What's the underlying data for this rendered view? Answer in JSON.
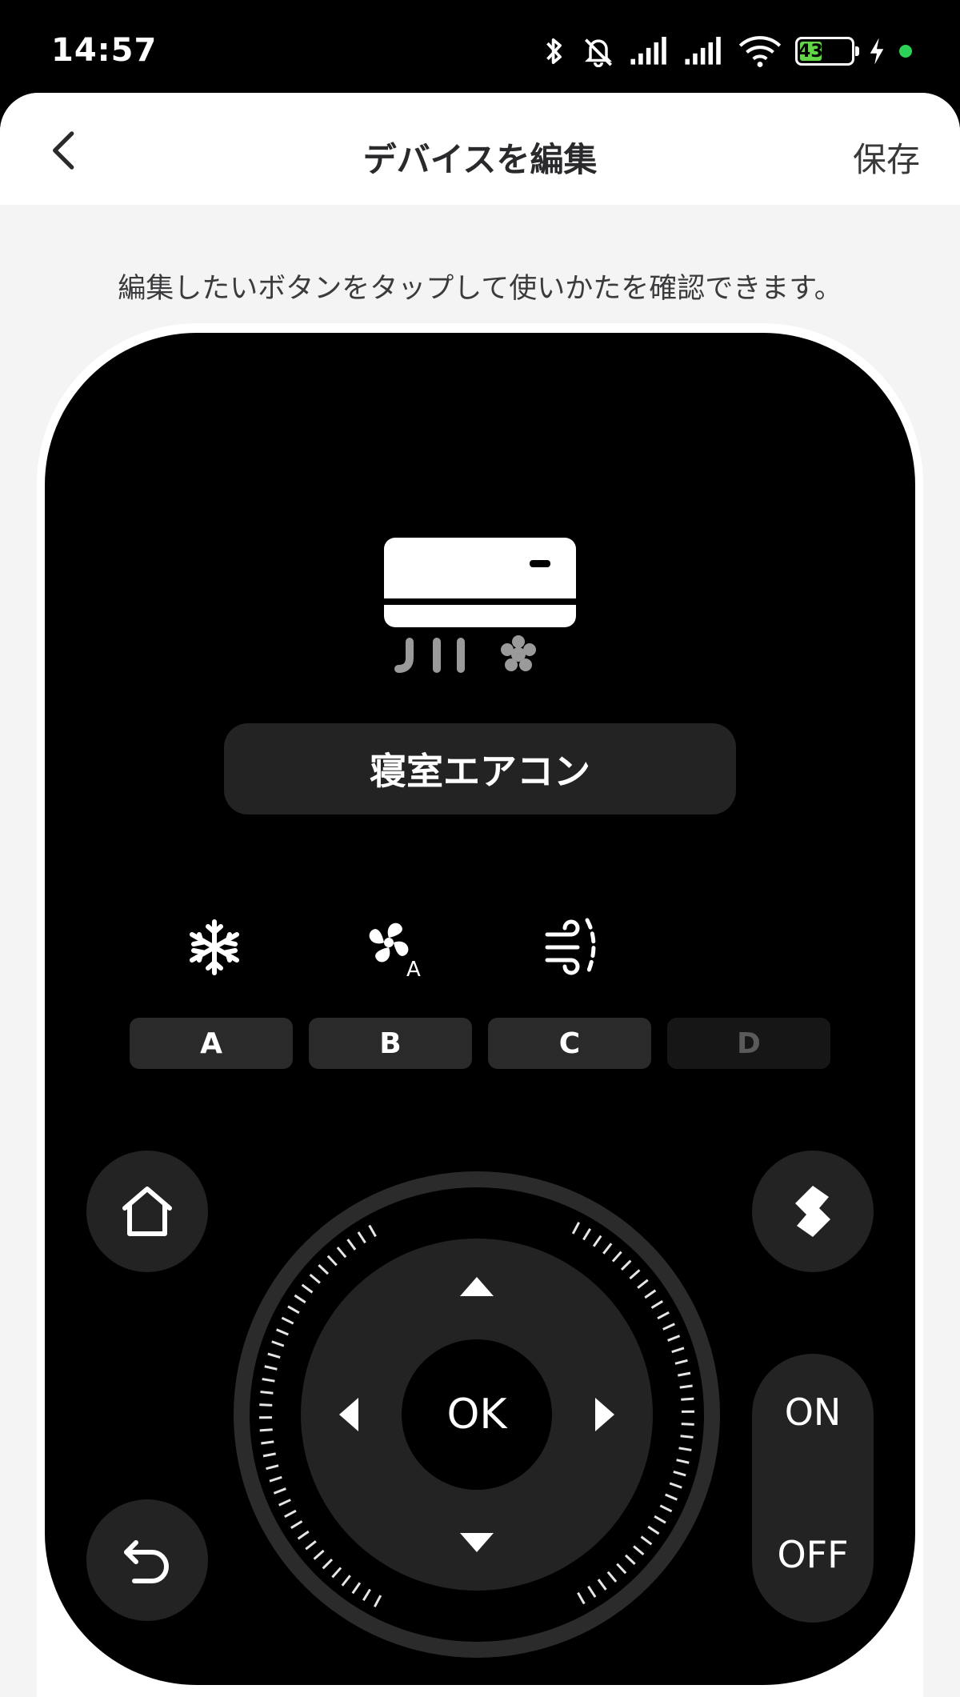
{
  "status_bar": {
    "time": "14:57",
    "battery_level": "43",
    "icons": [
      "bluetooth-icon",
      "mute-icon",
      "signal-icon",
      "signal-icon",
      "wifi-icon",
      "battery-icon",
      "charging-icon",
      "green-dot-icon"
    ]
  },
  "header": {
    "back_icon": "chevron-left-icon",
    "title": "デバイスを編集",
    "save_label": "保存"
  },
  "hint": "編集したいボタンをタップして使いかたを確認できます。",
  "remote": {
    "device_icon": "air-conditioner-icon",
    "device_name": "寝室エアコン",
    "mode_icons": [
      "snowflake-icon",
      "fan-auto-icon",
      "wind-swing-icon"
    ],
    "keys": [
      {
        "label": "A",
        "enabled": true
      },
      {
        "label": "B",
        "enabled": true
      },
      {
        "label": "C",
        "enabled": true
      },
      {
        "label": "D",
        "enabled": false
      }
    ],
    "ok_label": "OK",
    "on_label": "ON",
    "off_label": "OFF",
    "round_buttons": [
      "home-icon",
      "switch-icon",
      "return-icon"
    ]
  },
  "colors": {
    "remote_bg": "#000000",
    "button_bg": "#232323",
    "sheet_bg": "#f4f4f5",
    "battery_green": "#64d448"
  }
}
